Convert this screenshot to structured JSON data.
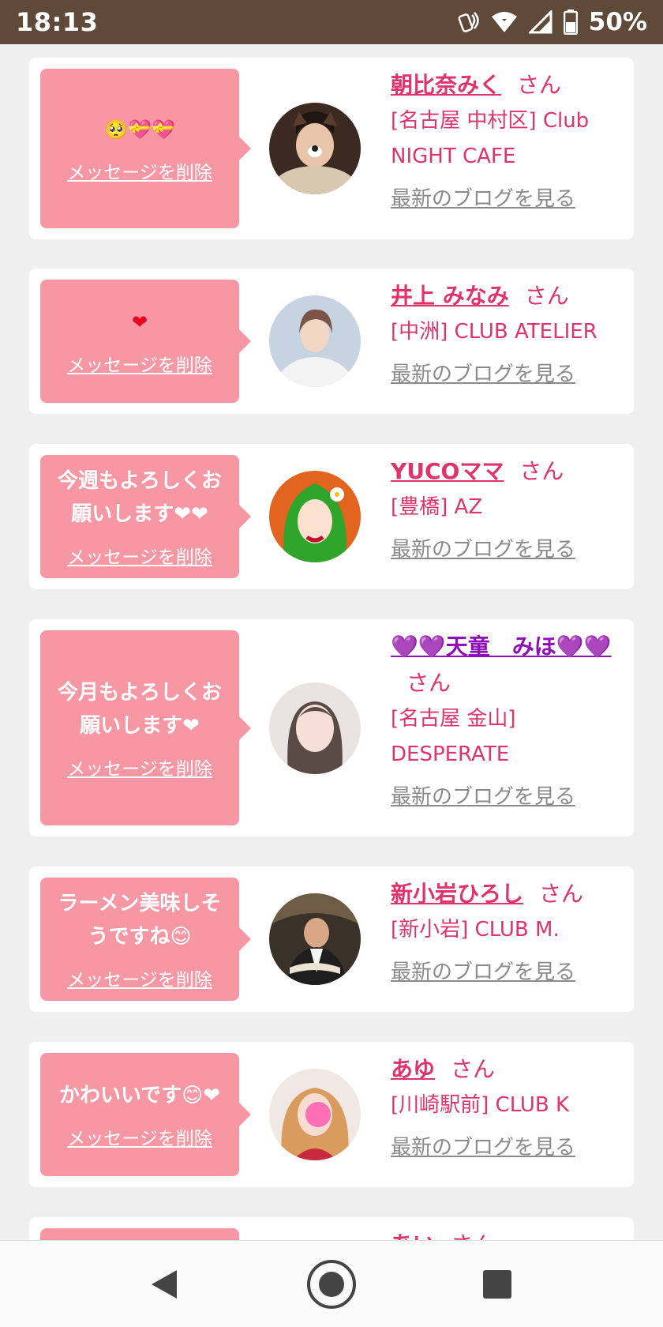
{
  "status": {
    "time": "18:13",
    "battery": "50%"
  },
  "common": {
    "delete_label": "メッセージを削除",
    "blog_label": "最新のブログを見る",
    "suffix": "さん"
  },
  "cards": [
    {
      "message": "🥺💝💝",
      "name": "朝比奈みく",
      "shop": "[名古屋 中村区] Club NIGHT CAFE"
    },
    {
      "message": "❤",
      "name": "井上 みなみ",
      "shop": "[中洲] CLUB ATELIER"
    },
    {
      "message": "今週もよろしくお願いします❤❤",
      "name": "YUCOママ",
      "shop": "[豊橋] AZ"
    },
    {
      "message": "今月もよろしくお願いします❤",
      "name": "💜💜天童　みほ💜💜",
      "shop": "[名古屋 金山] DESPERATE"
    },
    {
      "message": "ラーメン美味しそうですね😊",
      "name": "新小岩ひろし",
      "shop": "[新小岩] CLUB M."
    },
    {
      "message": "かわいいです😊❤",
      "name": "あゆ",
      "shop": "[川崎駅前] CLUB K"
    },
    {
      "name": "あい"
    }
  ],
  "colors": {
    "status_bar": "#5f4a3a",
    "bubble": "#f797a4",
    "accent": "#e0336a",
    "link_gray": "#8a8a8a"
  }
}
